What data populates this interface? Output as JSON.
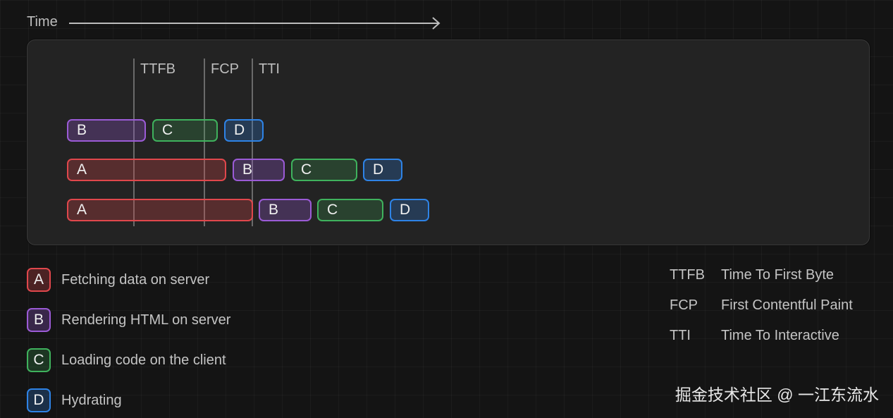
{
  "axis": {
    "label": "Time"
  },
  "markers": [
    {
      "id": "ttfb",
      "label": "TTFB"
    },
    {
      "id": "fcp",
      "label": "FCP"
    },
    {
      "id": "tti",
      "label": "TTI"
    }
  ],
  "rows": [
    {
      "bars": [
        {
          "key": "B",
          "label": "B"
        },
        {
          "key": "C",
          "label": "C"
        },
        {
          "key": "D",
          "label": "D"
        }
      ]
    },
    {
      "bars": [
        {
          "key": "A",
          "label": "A"
        },
        {
          "key": "B",
          "label": "B"
        },
        {
          "key": "C",
          "label": "C"
        },
        {
          "key": "D",
          "label": "D"
        }
      ]
    },
    {
      "bars": [
        {
          "key": "A",
          "label": "A"
        },
        {
          "key": "B",
          "label": "B"
        },
        {
          "key": "C",
          "label": "C"
        },
        {
          "key": "D",
          "label": "D"
        }
      ]
    }
  ],
  "legend": [
    {
      "key": "A",
      "text": "Fetching data on server",
      "color": "#e0474c"
    },
    {
      "key": "B",
      "text": "Rendering HTML on server",
      "color": "#9b5bd6"
    },
    {
      "key": "C",
      "text": "Loading code on the client",
      "color": "#3fb25d"
    },
    {
      "key": "D",
      "text": "Hydrating",
      "color": "#2e83e6"
    }
  ],
  "abbreviations": [
    {
      "abbr": "TTFB",
      "full": "Time To First Byte"
    },
    {
      "abbr": "FCP",
      "full": "First Contentful Paint"
    },
    {
      "abbr": "TTI",
      "full": "Time To Interactive"
    }
  ],
  "watermark": "掘金技术社区 @ 一江东流水"
}
